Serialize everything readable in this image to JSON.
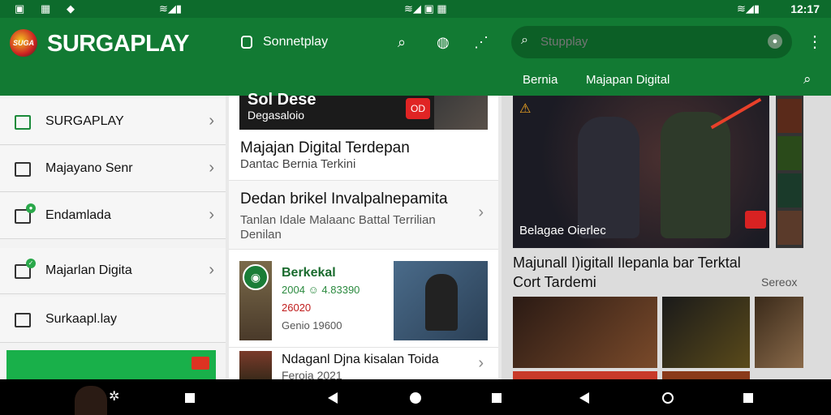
{
  "status": {
    "time": "12:17"
  },
  "appbar": {
    "brand": "SURGAPLAY",
    "logo_text": "SUGA",
    "tab_label": "Sonnetplay",
    "search_placeholder": "Stupplay",
    "subtabs": [
      "Bernia",
      "Majapan Digital"
    ]
  },
  "sidebar": {
    "items": [
      {
        "label": "SURGAPLAY",
        "icon": "app-icon"
      },
      {
        "label": "Majayano Senr",
        "icon": "folder-icon"
      },
      {
        "label": "Endamlada",
        "icon": "home-icon"
      },
      {
        "label": "Majarlan Digita",
        "icon": "task-icon"
      },
      {
        "label": "Surkaapl.lay",
        "icon": "folder-icon"
      }
    ]
  },
  "middle": {
    "hero_title": "Sol Dese",
    "hero_sub": "Degasaloio",
    "hero_badge": "OD",
    "title": "Majajan Digital Terdepan",
    "subtitle": "Dantac Bernia Terkini",
    "card2": {
      "title": "Dedan brikel Invalpalnepamita",
      "line1": "Tanlan Idale Malaanc Battal Terrilian",
      "line2": "Denilan"
    },
    "card3": {
      "title": "Berkekal",
      "line1": "2004 ☺ 4.83390",
      "line2": "26020",
      "line3": "Genio      19600"
    },
    "card4": {
      "title": "Ndaganl Djna kisalan Toida",
      "sub": "Feroia 2021"
    }
  },
  "right": {
    "hero_caption": "Belagae Oierlec",
    "title": "Majunall I)igitall Ilepanla bar Terktal Cort Tardemi",
    "more": "Sereox"
  },
  "colors": {
    "brand_green": "#127a33",
    "status_green": "#0d6b2c",
    "accent_red": "#e02424"
  }
}
